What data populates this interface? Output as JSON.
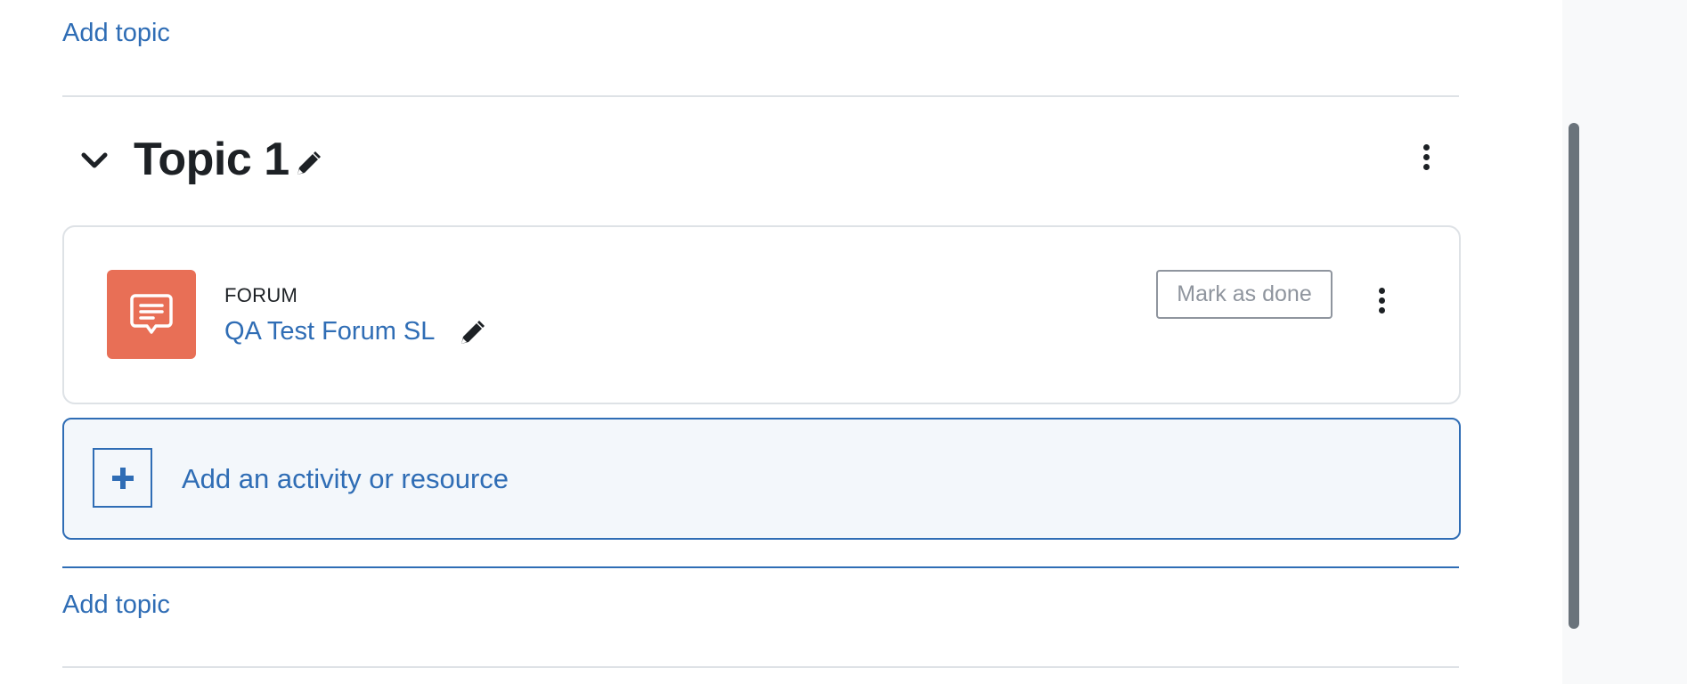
{
  "section": {
    "add_topic_top": "Add topic",
    "title": "Topic 1",
    "add_topic_bottom": "Add topic"
  },
  "activity": {
    "type": "FORUM",
    "name": "QA Test Forum SL",
    "mark_done_label": "Mark as done",
    "icon": "forum-icon",
    "icon_color": "#e86f56"
  },
  "add_activity": {
    "label": "Add an activity or resource"
  },
  "colors": {
    "link": "#2f6db5",
    "text": "#1d2125",
    "border": "#dee2e6",
    "add_activity_bg": "#f3f7fb"
  }
}
